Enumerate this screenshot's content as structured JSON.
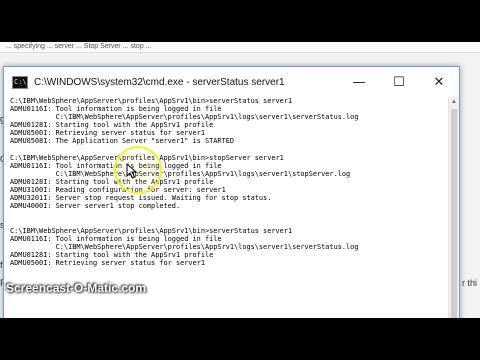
{
  "background_doc": {
    "top_strip": "... specifying ... server ... Stop Server ... stop ... ",
    "left_fragments": [
      "ge",
      "Ge",
      "s",
      "fra",
      "Fa"
    ],
    "right_fragment": "r thi"
  },
  "window": {
    "title": "C:\\WINDOWS\\system32\\cmd.exe - serverStatus  server1",
    "icon_glyph": "C:\\",
    "minimize_symbol": "—",
    "maximize_symbol": "☐",
    "close_symbol": "✕"
  },
  "console": {
    "lines": [
      "C:\\IBM\\WebSphere\\AppServer\\profiles\\AppSrv1\\bin>serverStatus server1",
      "ADMU0116I: Tool information is being logged in file",
      "           C:\\IBM\\WebSphere\\AppServer\\profiles\\AppSrv1\\logs\\server1\\serverStatus.log",
      "ADMU0128I: Starting tool with the AppSrv1 profile",
      "ADMU0500I: Retrieving server status for server1",
      "ADMU0508I: The Application Server \"server1\" is STARTED",
      "",
      "C:\\IBM\\WebSphere\\AppServer\\profiles\\AppSrv1\\bin>stopServer server1",
      "ADMU0116I: Tool information is being logged in file",
      "           C:\\IBM\\WebSphere\\AppServer\\profiles\\AppSrv1\\logs\\server1\\stopServer.log",
      "ADMU0128I: Starting tool with the AppSrv1 profile",
      "ADMU3100I: Reading configuration for server: server1",
      "ADMU3201I: Server stop request issued. Waiting for stop status.",
      "ADMU4000I: Server server1 stop completed.",
      "",
      "",
      "C:\\IBM\\WebSphere\\AppServer\\profiles\\AppSrv1\\bin>serverStatus server1",
      "ADMU0116I: Tool information is being logged in file",
      "           C:\\IBM\\WebSphere\\AppServer\\profiles\\AppSrv1\\logs\\server1\\serverStatus.log",
      "ADMU0128I: Starting tool with the AppSrv1 profile",
      "ADMU0500I: Retrieving server status for server1"
    ]
  },
  "watermark": "Screencast-O-Matic.com",
  "colors": {
    "letterbox": "#000000",
    "console_bg": "#ffffff",
    "console_text": "#000000",
    "cursor_highlight": "#f2f22a",
    "window_border": "#6b9bd1"
  }
}
